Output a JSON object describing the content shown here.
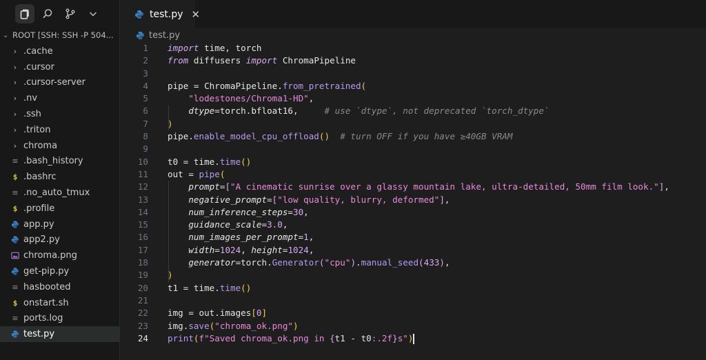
{
  "activity": [
    "files-icon",
    "search-icon",
    "source-control-icon",
    "chevron-down-icon"
  ],
  "explorer": {
    "root": "ROOT [SSH: SSH -P 504...",
    "items": [
      {
        "label": ".cache",
        "kind": "folder"
      },
      {
        "label": ".cursor",
        "kind": "folder"
      },
      {
        "label": ".cursor-server",
        "kind": "folder"
      },
      {
        "label": ".nv",
        "kind": "folder"
      },
      {
        "label": ".ssh",
        "kind": "folder"
      },
      {
        "label": ".triton",
        "kind": "folder"
      },
      {
        "label": "chroma",
        "kind": "folder"
      },
      {
        "label": ".bash_history",
        "kind": "text"
      },
      {
        "label": ".bashrc",
        "kind": "shell"
      },
      {
        "label": ".no_auto_tmux",
        "kind": "text"
      },
      {
        "label": ".profile",
        "kind": "shell"
      },
      {
        "label": "app.py",
        "kind": "python"
      },
      {
        "label": "app2.py",
        "kind": "python"
      },
      {
        "label": "chroma.png",
        "kind": "image"
      },
      {
        "label": "get-pip.py",
        "kind": "python"
      },
      {
        "label": "hasbooted",
        "kind": "text"
      },
      {
        "label": "onstart.sh",
        "kind": "shell"
      },
      {
        "label": "ports.log",
        "kind": "text"
      },
      {
        "label": "test.py",
        "kind": "python",
        "selected": true
      }
    ]
  },
  "tab": {
    "label": "test.py",
    "close": "✕"
  },
  "breadcrumb": "test.py",
  "code": {
    "current_line": 24,
    "lines": [
      [
        [
          "kw",
          "import"
        ],
        [
          "pl",
          " time, torch"
        ]
      ],
      [
        [
          "kw",
          "from"
        ],
        [
          "pl",
          " diffusers "
        ],
        [
          "kw",
          "import"
        ],
        [
          "pl",
          " ChromaPipeline"
        ]
      ],
      [],
      [
        [
          "pl",
          "pipe = ChromaPipeline."
        ],
        [
          "fn",
          "from_pretrained"
        ],
        [
          "br1",
          "("
        ]
      ],
      [
        [
          "pl",
          "    "
        ],
        [
          "str",
          "\"lodestones/Chroma1-HD\""
        ],
        [
          "pl",
          ","
        ]
      ],
      [
        [
          "pl",
          "    "
        ],
        [
          "prm",
          "dtype"
        ],
        [
          "pl",
          "=torch.bfloat16,     "
        ],
        [
          "cm",
          "# use `dtype`, not deprecated `torch_dtype`"
        ]
      ],
      [
        [
          "br1",
          ")"
        ]
      ],
      [
        [
          "pl",
          "pipe."
        ],
        [
          "fn",
          "enable_model_cpu_offload"
        ],
        [
          "br1",
          "()"
        ],
        [
          "pl",
          "  "
        ],
        [
          "cm",
          "# turn OFF if you have ≥40GB VRAM"
        ]
      ],
      [],
      [
        [
          "pl",
          "t0 = time."
        ],
        [
          "fn",
          "time"
        ],
        [
          "br1",
          "()"
        ]
      ],
      [
        [
          "pl",
          "out = "
        ],
        [
          "fn",
          "pipe"
        ],
        [
          "br1",
          "("
        ]
      ],
      [
        [
          "pl",
          "    "
        ],
        [
          "prm",
          "prompt"
        ],
        [
          "pl",
          "="
        ],
        [
          "br2",
          "["
        ],
        [
          "str",
          "\"A cinematic sunrise over a glassy mountain lake, ultra-detailed, 50mm film look.\""
        ],
        [
          "br2",
          "]"
        ],
        [
          "pl",
          ","
        ]
      ],
      [
        [
          "pl",
          "    "
        ],
        [
          "prm",
          "negative_prompt"
        ],
        [
          "pl",
          "="
        ],
        [
          "br2",
          "["
        ],
        [
          "str",
          "\"low quality, blurry, deformed\""
        ],
        [
          "br2",
          "]"
        ],
        [
          "pl",
          ","
        ]
      ],
      [
        [
          "pl",
          "    "
        ],
        [
          "prm",
          "num_inference_steps"
        ],
        [
          "pl",
          "="
        ],
        [
          "num",
          "30"
        ],
        [
          "pl",
          ","
        ]
      ],
      [
        [
          "pl",
          "    "
        ],
        [
          "prm",
          "guidance_scale"
        ],
        [
          "pl",
          "="
        ],
        [
          "num",
          "3.0"
        ],
        [
          "pl",
          ","
        ]
      ],
      [
        [
          "pl",
          "    "
        ],
        [
          "prm",
          "num_images_per_prompt"
        ],
        [
          "pl",
          "="
        ],
        [
          "num",
          "1"
        ],
        [
          "pl",
          ","
        ]
      ],
      [
        [
          "pl",
          "    "
        ],
        [
          "prm",
          "width"
        ],
        [
          "pl",
          "="
        ],
        [
          "num",
          "1024"
        ],
        [
          "pl",
          ", "
        ],
        [
          "prm",
          "height"
        ],
        [
          "pl",
          "="
        ],
        [
          "num",
          "1024"
        ],
        [
          "pl",
          ","
        ]
      ],
      [
        [
          "pl",
          "    "
        ],
        [
          "prm",
          "generator"
        ],
        [
          "pl",
          "=torch."
        ],
        [
          "fn",
          "Generator"
        ],
        [
          "br2",
          "("
        ],
        [
          "str",
          "\"cpu\""
        ],
        [
          "br2",
          ")"
        ],
        [
          "pl",
          "."
        ],
        [
          "fn",
          "manual_seed"
        ],
        [
          "br2",
          "("
        ],
        [
          "num",
          "433"
        ],
        [
          "br2",
          ")"
        ],
        [
          "pl",
          ","
        ]
      ],
      [
        [
          "br1",
          ")"
        ]
      ],
      [
        [
          "pl",
          "t1 = time."
        ],
        [
          "fn",
          "time"
        ],
        [
          "br1",
          "()"
        ]
      ],
      [],
      [
        [
          "pl",
          "img = out.images"
        ],
        [
          "br1",
          "["
        ],
        [
          "num",
          "0"
        ],
        [
          "br1",
          "]"
        ]
      ],
      [
        [
          "pl",
          "img."
        ],
        [
          "fn",
          "save"
        ],
        [
          "br1",
          "("
        ],
        [
          "str",
          "\"chroma_ok.png\""
        ],
        [
          "br1",
          ")"
        ]
      ],
      [
        [
          "fn",
          "print"
        ],
        [
          "br1",
          "("
        ],
        [
          "str",
          "f\"Saved chroma_ok.png in "
        ],
        [
          "br2",
          "{"
        ],
        [
          "pl",
          "t1 - t0"
        ],
        [
          "str",
          ":.2f"
        ],
        [
          "br2",
          "}"
        ],
        [
          "str",
          "s\""
        ],
        [
          "br1",
          ")"
        ],
        [
          "cursor",
          ""
        ]
      ]
    ]
  }
}
